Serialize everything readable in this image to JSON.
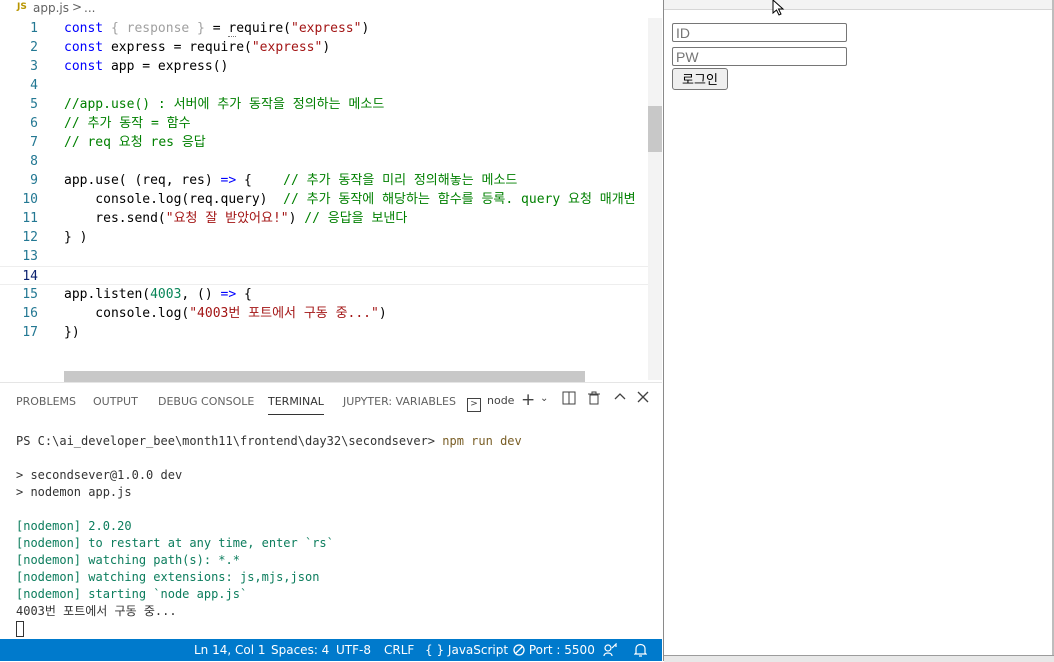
{
  "breadcrumb": {
    "badge": "JS",
    "file": "app.js",
    "sep": ">",
    "ellipsis": "..."
  },
  "editor": {
    "current_line": 14,
    "lines": [
      {
        "n": "1",
        "parts": [
          [
            "kw",
            "const "
          ],
          [
            "fad",
            "{ response } "
          ],
          [
            "",
            "= "
          ],
          [
            "hl",
            "r"
          ],
          [
            "",
            "equire("
          ],
          [
            "str",
            "\"express\""
          ],
          [
            "",
            ")"
          ]
        ]
      },
      {
        "n": "2",
        "parts": [
          [
            "kw",
            "const "
          ],
          [
            "",
            "express = require("
          ],
          [
            "str",
            "\"express\""
          ],
          [
            "",
            ")"
          ]
        ]
      },
      {
        "n": "3",
        "parts": [
          [
            "kw",
            "const "
          ],
          [
            "",
            "app = express()"
          ]
        ]
      },
      {
        "n": "4",
        "parts": []
      },
      {
        "n": "5",
        "parts": [
          [
            "cm",
            "//app.use() : 서버에 추가 동작을 정의하는 메소드"
          ]
        ]
      },
      {
        "n": "6",
        "parts": [
          [
            "cm",
            "// 추가 동작 = 함수"
          ]
        ]
      },
      {
        "n": "7",
        "parts": [
          [
            "cm",
            "// req 요청 res 응답"
          ]
        ]
      },
      {
        "n": "8",
        "parts": []
      },
      {
        "n": "9",
        "parts": [
          [
            "",
            "app.use( (req, res) "
          ],
          [
            "kw",
            "=> "
          ],
          [
            "",
            "{    "
          ],
          [
            "cm",
            "// 추가 동작을 미리 정의해놓는 메소드"
          ]
        ]
      },
      {
        "n": "10",
        "parts": [
          [
            "",
            "    console.log(req.query)  "
          ],
          [
            "cm",
            "// 추가 동작에 해당하는 함수를 등록. query 요청 매개변"
          ]
        ]
      },
      {
        "n": "11",
        "parts": [
          [
            "",
            "    res.send("
          ],
          [
            "str",
            "\"요청 잘 받았어요!\""
          ],
          [
            "",
            ") "
          ],
          [
            "cm",
            "// 응답을 보낸다"
          ]
        ]
      },
      {
        "n": "12",
        "parts": [
          [
            "",
            "} )"
          ]
        ]
      },
      {
        "n": "13",
        "parts": []
      },
      {
        "n": "14",
        "parts": []
      },
      {
        "n": "15",
        "parts": [
          [
            "",
            "app.listen("
          ],
          [
            "num",
            "4003"
          ],
          [
            "",
            ", () "
          ],
          [
            "kw",
            "=> "
          ],
          [
            "",
            "{"
          ]
        ]
      },
      {
        "n": "16",
        "parts": [
          [
            "",
            "    console.log("
          ],
          [
            "str",
            "\"4003번 포트에서 구동 중...\""
          ],
          [
            "",
            ")"
          ]
        ]
      },
      {
        "n": "17",
        "parts": [
          [
            "",
            "})"
          ]
        ]
      }
    ]
  },
  "panel": {
    "tabs": [
      "PROBLEMS",
      "OUTPUT",
      "DEBUG CONSOLE",
      "TERMINAL",
      "JUPYTER: VARIABLES"
    ],
    "active_tab": "TERMINAL",
    "terminal_name": "node",
    "icons": {
      "terminal": "terminal-icon",
      "add": "plus-icon",
      "dropdown": "chevron-down-icon",
      "split": "split-icon",
      "trash": "trash-icon",
      "maximize": "chevron-up-icon",
      "close": "close-icon"
    }
  },
  "terminal": {
    "prompt": "PS C:\\ai_developer_bee\\month11\\frontend\\day32\\secondsever> ",
    "command": "npm run dev",
    "lines": [
      "> secondsever@1.0.0 dev",
      "> nodemon app.js",
      "[nodemon] 2.0.20",
      "[nodemon] to restart at any time, enter `rs`",
      "[nodemon] watching path(s): *.*",
      "[nodemon] watching extensions: js,mjs,json",
      "[nodemon] starting `node app.js`",
      "4003번 포트에서 구동 중..."
    ]
  },
  "status": {
    "position": "Ln 14, Col 1",
    "spaces": "Spaces: 4",
    "encoding": "UTF-8",
    "eol": "CRLF",
    "language_icon": "{ }",
    "language": "JavaScript",
    "port": "Port : 5500",
    "port_icon": "no-entry-icon",
    "feedback_icon": "feedback-icon",
    "bell_icon": "bell-icon"
  },
  "browser": {
    "id_placeholder": "ID",
    "pw_placeholder": "PW",
    "login_label": "로그인"
  }
}
